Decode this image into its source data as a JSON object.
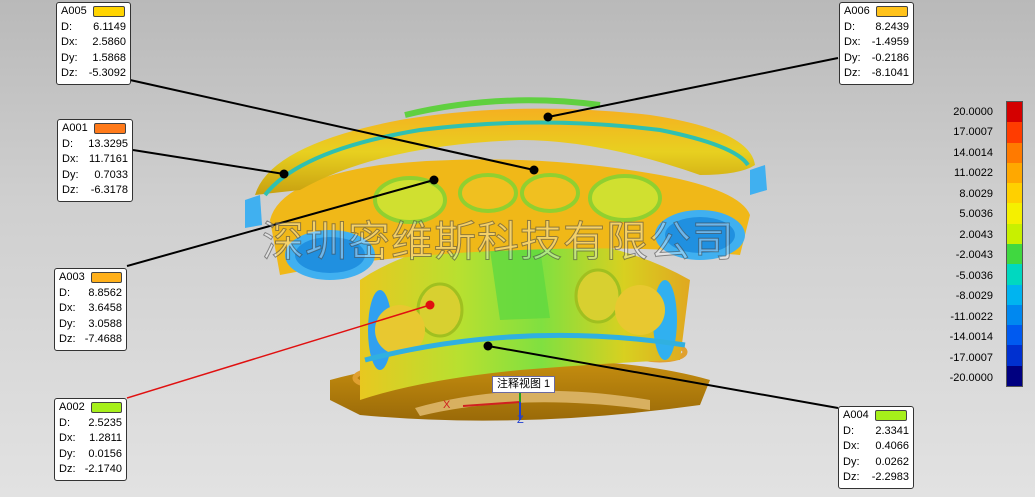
{
  "watermark": "深圳密维斯科技有限公司",
  "view_label": "注释视图 1",
  "axes": {
    "x": "X",
    "z": "Z"
  },
  "annotations": [
    {
      "id": "A005",
      "color": "#ffd400",
      "D": "6.1149",
      "Dx": "2.5860",
      "Dy": "1.5868",
      "Dz": "-5.3092"
    },
    {
      "id": "A006",
      "color": "#ffc21a",
      "D": "8.2439",
      "Dx": "-1.4959",
      "Dy": "-0.2186",
      "Dz": "-8.1041"
    },
    {
      "id": "A001",
      "color": "#ff7a1a",
      "D": "13.3295",
      "Dx": "11.7161",
      "Dy": "0.7033",
      "Dz": "-6.3178"
    },
    {
      "id": "A003",
      "color": "#ffb01a",
      "D": "8.8562",
      "Dx": "3.6458",
      "Dy": "3.0588",
      "Dz": "-7.4688"
    },
    {
      "id": "A002",
      "color": "#a6f01a",
      "D": "2.5235",
      "Dx": "1.2811",
      "Dy": "0.0156",
      "Dz": "-2.1740"
    },
    {
      "id": "A004",
      "color": "#a6f01a",
      "D": "2.3341",
      "Dx": "0.4066",
      "Dy": "0.0262",
      "Dz": "-2.2983"
    }
  ],
  "labels": {
    "D": "D:",
    "Dx": "Dx:",
    "Dy": "Dy:",
    "Dz": "Dz:"
  },
  "scale": {
    "ticks": [
      "20.0000",
      "17.0007",
      "14.0014",
      "11.0022",
      "8.0029",
      "5.0036",
      "2.0043",
      "-2.0043",
      "-5.0036",
      "-8.0029",
      "-11.0022",
      "-14.0014",
      "-17.0007",
      "-20.0000"
    ],
    "colors": [
      "#d40000",
      "#ff3c00",
      "#ff7a00",
      "#ffa800",
      "#ffd000",
      "#f5f000",
      "#c8f000",
      "#40d840",
      "#00d8c0",
      "#00b4f0",
      "#0088f0",
      "#005af0",
      "#0030d0",
      "#000080"
    ]
  }
}
